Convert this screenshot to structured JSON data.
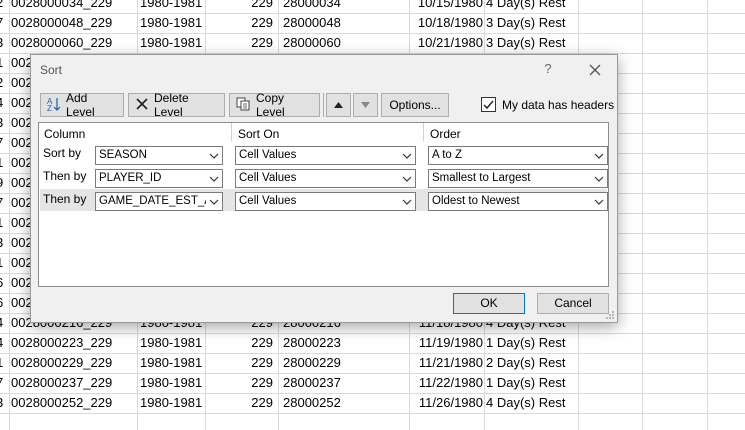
{
  "sheet": {
    "rows": [
      {
        "a": "2",
        "id": "0028000034_229",
        "season": "1980-1981",
        "num": "229",
        "game": "28000034",
        "date": "10/15/1980",
        "rest": "4 Day(s) Rest"
      },
      {
        "a": "7",
        "id": "0028000048_229",
        "season": "1980-1981",
        "num": "229",
        "game": "28000048",
        "date": "10/18/1980",
        "rest": "3 Day(s) Rest"
      },
      {
        "a": "3",
        "id": "0028000060_229",
        "season": "1980-1981",
        "num": "229",
        "game": "28000060",
        "date": "10/21/1980",
        "rest": "3 Day(s) Rest"
      },
      {
        "a": "1",
        "id": "002",
        "season": "",
        "num": "",
        "game": "",
        "date": "",
        "rest": ""
      },
      {
        "a": "2",
        "id": "002",
        "season": "",
        "num": "",
        "game": "",
        "date": "",
        "rest": ""
      },
      {
        "a": "4",
        "id": "002",
        "season": "",
        "num": "",
        "game": "",
        "date": "",
        "rest": ""
      },
      {
        "a": "3",
        "id": "002",
        "season": "",
        "num": "",
        "game": "",
        "date": "",
        "rest": ""
      },
      {
        "a": "7",
        "id": "002",
        "season": "",
        "num": "",
        "game": "",
        "date": "",
        "rest": ""
      },
      {
        "a": "1",
        "id": "002",
        "season": "",
        "num": "",
        "game": "",
        "date": "",
        "rest": ""
      },
      {
        "a": "9",
        "id": "002",
        "season": "",
        "num": "",
        "game": "",
        "date": "",
        "rest": ""
      },
      {
        "a": "7",
        "id": "002",
        "season": "",
        "num": "",
        "game": "",
        "date": "",
        "rest": ""
      },
      {
        "a": "1",
        "id": "002",
        "season": "",
        "num": "",
        "game": "",
        "date": "",
        "rest": ""
      },
      {
        "a": "3",
        "id": "002",
        "season": "",
        "num": "",
        "game": "",
        "date": "",
        "rest": ""
      },
      {
        "a": "1",
        "id": "002",
        "season": "",
        "num": "",
        "game": "",
        "date": "",
        "rest": ""
      },
      {
        "a": "6",
        "id": "002",
        "season": "",
        "num": "",
        "game": "",
        "date": "",
        "rest": ""
      },
      {
        "a": "6",
        "id": "002",
        "season": "",
        "num": "",
        "game": "",
        "date": "",
        "rest": ""
      },
      {
        "a": "4",
        "id": "0028000216_229",
        "season": "1980-1981",
        "num": "229",
        "game": "28000216",
        "date": "11/18/1980",
        "rest": "4 Day(s) Rest"
      },
      {
        "a": "4",
        "id": "0028000223_229",
        "season": "1980-1981",
        "num": "229",
        "game": "28000223",
        "date": "11/19/1980",
        "rest": "1 Day(s) Rest"
      },
      {
        "a": "1",
        "id": "0028000229_229",
        "season": "1980-1981",
        "num": "229",
        "game": "28000229",
        "date": "11/21/1980",
        "rest": "2 Day(s) Rest"
      },
      {
        "a": "7",
        "id": "0028000237_229",
        "season": "1980-1981",
        "num": "229",
        "game": "28000237",
        "date": "11/22/1980",
        "rest": "1 Day(s) Rest"
      },
      {
        "a": "3",
        "id": "0028000252_229",
        "season": "1980-1981",
        "num": "229",
        "game": "28000252",
        "date": "11/26/1980",
        "rest": "4 Day(s) Rest"
      }
    ]
  },
  "dialog": {
    "title": "Sort",
    "help": "?",
    "toolbar": {
      "add_level": "Add Level",
      "delete_level": "Delete Level",
      "copy_level": "Copy Level",
      "options": "Options..."
    },
    "my_data_has_headers": {
      "label": "My data has headers",
      "checked": true
    },
    "columns": {
      "column": "Column",
      "sort_on": "Sort On",
      "order": "Order"
    },
    "levels": [
      {
        "label": "Sort by",
        "column": "SEASON",
        "sort_on": "Cell Values",
        "order": "A to Z",
        "selected": false
      },
      {
        "label": "Then by",
        "column": "PLAYER_ID",
        "sort_on": "Cell Values",
        "order": "Smallest to Largest",
        "selected": false
      },
      {
        "label": "Then by",
        "column": "GAME_DATE_EST_AD",
        "sort_on": "Cell Values",
        "order": "Oldest to Newest",
        "selected": true
      }
    ],
    "ok": "OK",
    "cancel": "Cancel",
    "colors": {
      "accent": "#0078d7",
      "selected_row": "#e5e5e5",
      "dialog_bg": "#f0f0f0"
    }
  }
}
